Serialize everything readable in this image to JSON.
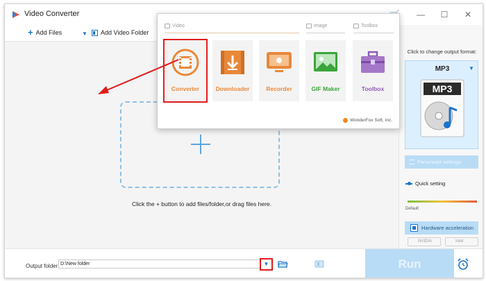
{
  "app": {
    "title": "Video Converter"
  },
  "window_buttons": {
    "minimize": "—",
    "maximize": "☐",
    "close": "✕"
  },
  "toolbar": {
    "add_files": "Add Files",
    "add_video_folder": "Add Video Folder"
  },
  "main": {
    "drop_hint": "Click the + button to add files/folder,or drag files here."
  },
  "popup": {
    "categories": [
      {
        "label": "Video"
      },
      {
        "label": "Image"
      },
      {
        "label": "Toolbox"
      }
    ],
    "tools": [
      {
        "label": "Converter",
        "icon": "film-icon"
      },
      {
        "label": "Downloader",
        "icon": "download-icon"
      },
      {
        "label": "Recorder",
        "icon": "screen-record-icon"
      },
      {
        "label": "GIF Maker",
        "icon": "image-icon"
      },
      {
        "label": "Toolbox",
        "icon": "toolbox-icon"
      }
    ],
    "brand": "WonderFox Soft, Inc."
  },
  "right_panel": {
    "title": "Click to change output format:",
    "format": "MP3",
    "format_art_text": "MP3",
    "parameter_settings": "Parameter settings",
    "quick_setting": "Quick setting",
    "slider_default": "Default",
    "hardware_acceleration": "Hardware acceleration",
    "gpu": {
      "nvidia": "NVIDIA",
      "intel": "Intel"
    }
  },
  "bottom": {
    "output_folder_label": "Output folder:",
    "output_folder_value": "D:\\New folder",
    "run": "Run"
  },
  "colors": {
    "accent": "#1b74c9",
    "highlight": "#e01b1b",
    "run_bg": "#b9dcf6",
    "tool_orange": "#e8883a"
  }
}
